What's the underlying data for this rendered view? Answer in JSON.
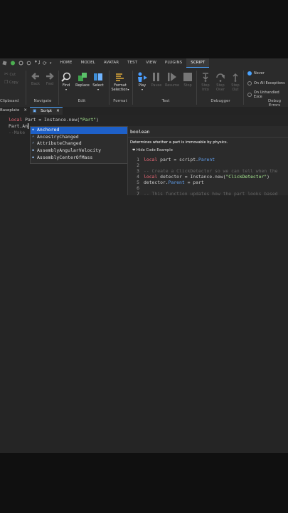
{
  "toolbar": {
    "tabs": [
      "HOME",
      "MODEL",
      "AVATAR",
      "TEST",
      "VIEW",
      "PLUGINS",
      "SCRIPT"
    ],
    "active_tab": "SCRIPT"
  },
  "ribbon": {
    "clipboard": {
      "cut": "Cut",
      "copy": "Copy",
      "label": "Clipboard"
    },
    "navigate": {
      "back": "Back",
      "fwd": "Fwd",
      "label": "Navigate"
    },
    "edit": {
      "find": "Find",
      "replace": "Replace",
      "select": "Select",
      "label": "Edit"
    },
    "format": {
      "format_selection_1": "Format",
      "format_selection_2": "Selection",
      "label": "Format"
    },
    "test": {
      "play": "Play",
      "pause": "Pause",
      "resume": "Resume",
      "stop": "Stop",
      "label": "Test"
    },
    "debugger": {
      "step_into_1": "Step",
      "step_into_2": "Into",
      "step_over_1": "Step",
      "step_over_2": "Over",
      "step_out_1": "Step",
      "step_out_2": "Out",
      "label": "Debugger"
    },
    "debug_errors": {
      "never": "Never",
      "all_exceptions": "On All Exceptions",
      "unhandled": "On Unhandled Exce",
      "label": "Debug Errors"
    }
  },
  "doc_tabs": [
    {
      "label": "Baseplate",
      "close": "✕"
    },
    {
      "label": "Script",
      "close": "✕"
    }
  ],
  "editor": {
    "line1_kw": "local",
    "line1_mid": " Part = Instance.new(",
    "line1_str": "\"Part\"",
    "line1_end": ")",
    "line2": "Part.An",
    "line3": "--Make"
  },
  "autocomplete": {
    "items": [
      "Anchored",
      "AncestryChanged",
      "AttributeChanged",
      "AssemblyAngularVelocity",
      "AssemblyCenterOfMass"
    ]
  },
  "doc_popup": {
    "type": "boolean",
    "description": "Determines whether a part is immovable by physics.",
    "hide_code": "Hide Code Example",
    "code": {
      "l1_kw": "local",
      "l1_rest": " part = script.",
      "l1_prop": "Parent",
      "l3": "-- Create a ClickDetector so we can tell when the",
      "l4_kw": "local",
      "l4_mid": " detector = Instance.new(",
      "l4_str": "\"ClickDetector\"",
      "l4_end": ")",
      "l5_a": "detector.",
      "l5_prop": "Parent",
      "l5_b": " = part",
      "l7": "-- This function updates how the part looks based"
    },
    "line_numbers": [
      "1",
      "2",
      "3",
      "4",
      "5",
      "6",
      "7"
    ]
  }
}
